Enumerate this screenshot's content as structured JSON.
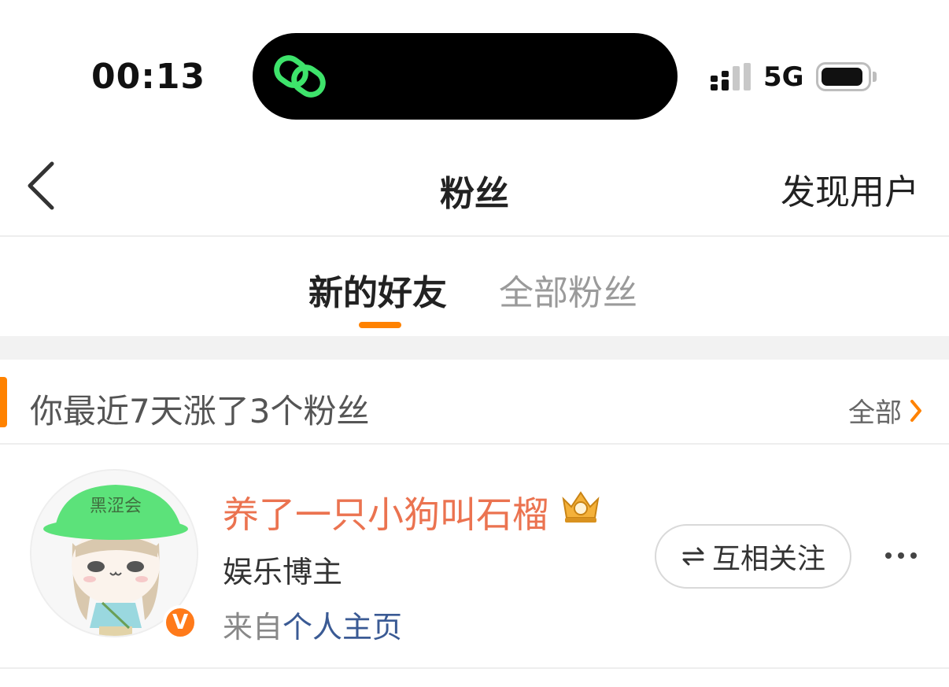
{
  "status_bar": {
    "time": "00:13",
    "network": "5G",
    "island_icon": "link-rings-icon",
    "island_icon_color": "#3ee36b"
  },
  "nav": {
    "back_icon": "chevron-left-icon",
    "title": "粉丝",
    "right_action": "发现用户"
  },
  "tabs": [
    {
      "label": "新的好友",
      "active": true
    },
    {
      "label": "全部粉丝",
      "active": false
    }
  ],
  "accent_color": "#ff8200",
  "section": {
    "title": "你最近7天涨了3个粉丝",
    "see_all": "全部"
  },
  "fans": [
    {
      "avatar_text": "黑涩会",
      "name": "养了一只小狗叫石榴",
      "name_color": "#eb7350",
      "badge_icon": "crown-icon",
      "verified_icon": "v-badge-icon",
      "verified_text": "V",
      "tag": "娱乐博主",
      "source_prefix": "来自",
      "source_link": "个人主页",
      "action_icon": "mutual-arrows-icon",
      "action_label": "互相关注",
      "more_icon": "more-dots-icon"
    }
  ]
}
